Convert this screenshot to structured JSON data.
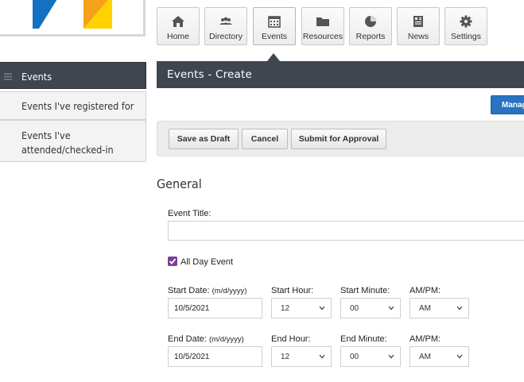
{
  "logo": {
    "registered_mark": "®"
  },
  "nav": {
    "items": [
      {
        "label": "Home",
        "icon": "home-icon"
      },
      {
        "label": "Directory",
        "icon": "people-icon"
      },
      {
        "label": "Events",
        "icon": "calendar-icon"
      },
      {
        "label": "Resources",
        "icon": "folder-icon"
      },
      {
        "label": "Reports",
        "icon": "pie-chart-icon"
      },
      {
        "label": "News",
        "icon": "newspaper-icon"
      },
      {
        "label": "Settings",
        "icon": "gear-icon"
      }
    ],
    "active": "Events"
  },
  "sidebar": {
    "items": [
      {
        "label": "Events"
      },
      {
        "label": "Events I've registered for"
      },
      {
        "label_line1": "Events I've",
        "label_line2": "attended/checked-in"
      }
    ]
  },
  "header": {
    "title": "Events - Create"
  },
  "manage_button": {
    "label": "Manag"
  },
  "actions": {
    "save_draft": "Save as Draft",
    "cancel": "Cancel",
    "submit": "Submit for Approval"
  },
  "form": {
    "section_title": "General",
    "event_title_label": "Event Title:",
    "event_title_value": "",
    "all_day_label": "All Day Event",
    "all_day_checked": true,
    "start": {
      "date_label": "Start Date:",
      "date_hint": "(m/d/yyyy)",
      "date_value": "10/5/2021",
      "hour_label": "Start Hour:",
      "hour_value": "12",
      "minute_label": "Start Minute:",
      "minute_value": "00",
      "ampm_label": "AM/PM:",
      "ampm_value": "AM"
    },
    "end": {
      "date_label": "End Date:",
      "date_hint": "(m/d/yyyy)",
      "date_value": "10/5/2021",
      "hour_label": "End Hour:",
      "hour_value": "12",
      "minute_label": "End Minute:",
      "minute_value": "00",
      "ampm_label": "AM/PM:",
      "ampm_value": "AM"
    }
  },
  "colors": {
    "dark_bar": "#3f4650",
    "accent_blue": "#2a73c2",
    "logo_blue": "#1470c0",
    "logo_orange": "#f6a11a",
    "logo_yellow": "#ffd200",
    "checkbox_purple": "#7b3f9a"
  }
}
